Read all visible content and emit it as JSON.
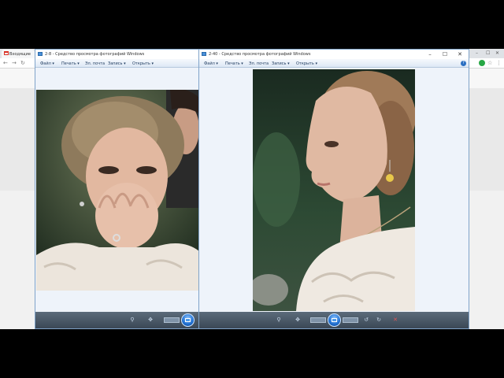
{
  "browser": {
    "tab_title": "Входящие",
    "accent_color": "#d93025"
  },
  "viewer_left": {
    "title": "2-8 - Средство просмотра фотографий Windows"
  },
  "viewer_right": {
    "title": "2-40 - Средство просмотра фотографий Windows",
    "window_controls": {
      "minimize": "–",
      "maximize": "☐",
      "close": "✕"
    }
  },
  "menu": {
    "file": "Файл ▾",
    "print": "Печать ▾",
    "email": "Эл. почта",
    "burn": "Запись ▾",
    "open": "Открыть ▾",
    "help": "?"
  },
  "colors": {
    "viewer_border": "#7fa3c9",
    "navbar": "#3b4856",
    "slideshow": "#1f6fd1"
  }
}
